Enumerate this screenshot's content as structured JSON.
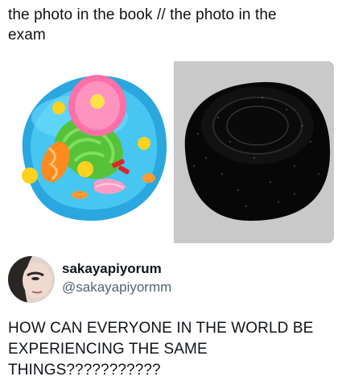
{
  "caption": "the photo in the book  //  the photo in the exam",
  "images": {
    "left": "animal-cell-diagram",
    "right": "dark-cell-micrograph"
  },
  "tweet": {
    "display_name": "sakayapiyorum",
    "handle": "@sakayapiyormm",
    "text": "HOW CAN EVERYONE IN THE WORLD BE EXPERIENCING THE SAME THINGS???????????"
  },
  "colors": {
    "cell_membrane": "#29b6e8",
    "nucleus": "#ff7fb2",
    "er": "#6ccf3a",
    "background_gray": "#c8c8c8"
  }
}
